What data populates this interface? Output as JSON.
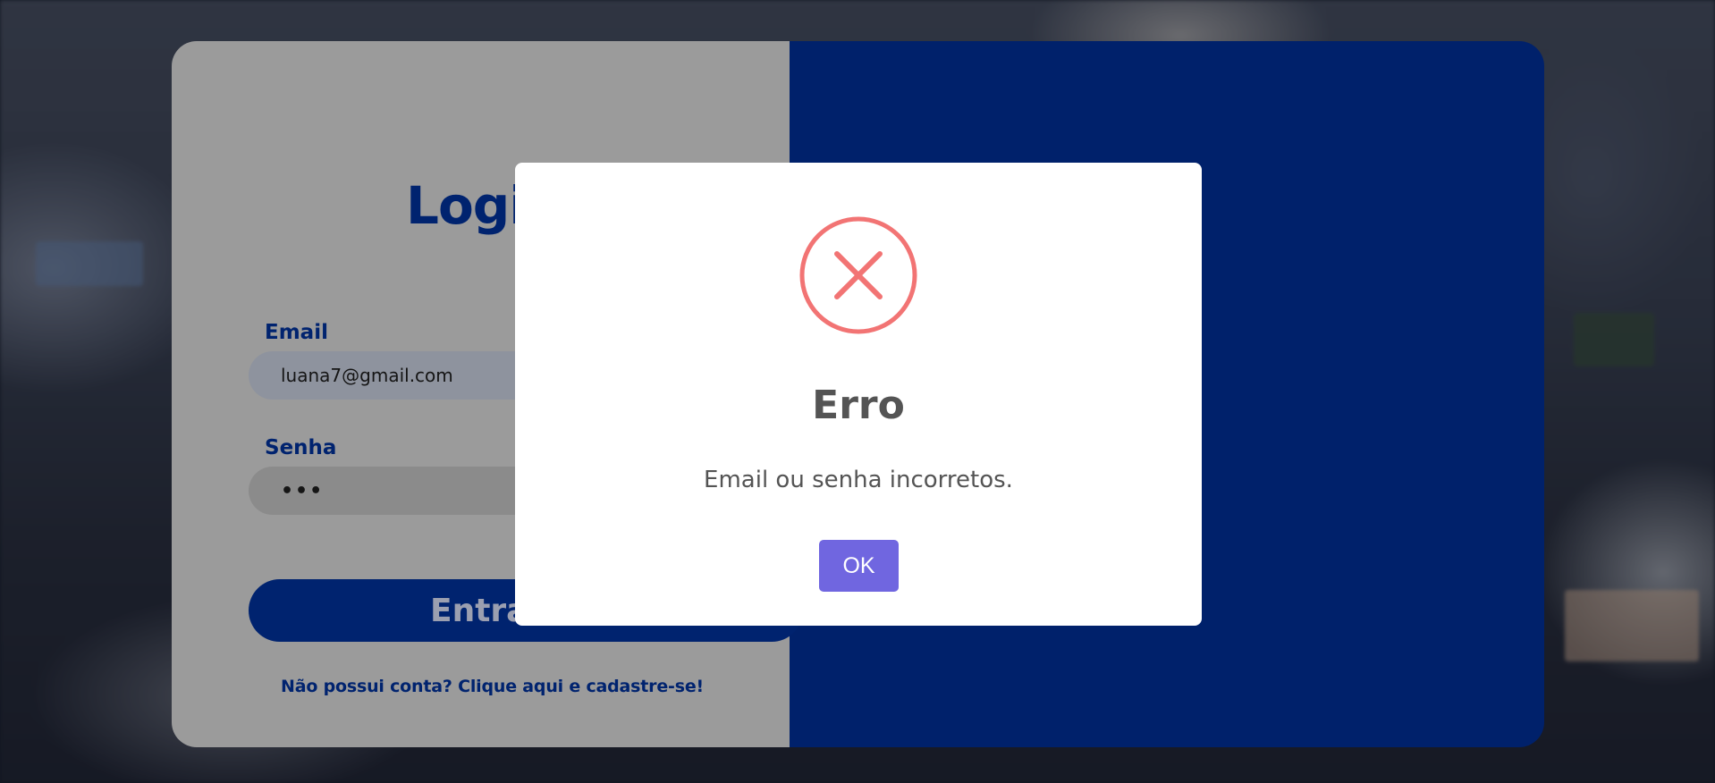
{
  "login": {
    "title": "Login",
    "email_label": "Email",
    "email_value": "luana7@gmail.com",
    "password_label": "Senha",
    "password_value": "•••",
    "submit_label": "Entrar",
    "signup_text": "Não possui conta? Clique aqui e cadastre-se!"
  },
  "modal": {
    "icon": "error-x-icon",
    "title": "Erro",
    "message": "Email ou senha incorretos.",
    "ok_label": "OK"
  },
  "colors": {
    "brand_blue": "#00216b",
    "error_red": "#f27474",
    "confirm_purple": "#7066e0"
  }
}
